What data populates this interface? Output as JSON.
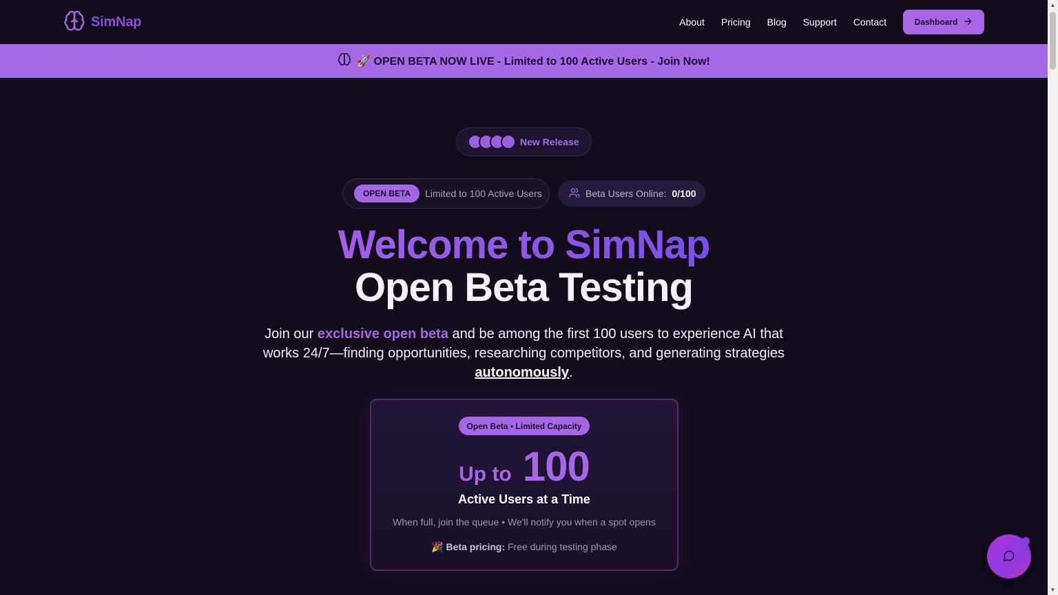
{
  "nav": {
    "brand": "SimNap",
    "links": [
      "About",
      "Pricing",
      "Blog",
      "Support",
      "Contact"
    ],
    "dashboard_label": "Dashboard"
  },
  "banner": {
    "text": "🚀 OPEN BETA NOW LIVE - Limited to 100 Active Users - Join Now!"
  },
  "release_pill": {
    "label": "New Release",
    "avatar_count": 4
  },
  "beta_pill": {
    "tag": "OPEN BETA",
    "text": "Limited to 100 Active Users"
  },
  "online_pill": {
    "label": "Beta Users Online:",
    "count": "0/100"
  },
  "hero": {
    "headline_line1": "Welcome to SimNap",
    "headline_line2": "Open Beta Testing",
    "sub_part1": "Join our ",
    "sub_highlight": "exclusive open beta",
    "sub_part2": " and be among the first 100 users to experience AI that works 24/7—finding opportunities, researching competitors, and generating strategies ",
    "sub_underline": "autonomously",
    "sub_end": "."
  },
  "capacity_card": {
    "badge": "Open Beta • Limited Capacity",
    "prefix": "Up to",
    "number": "100",
    "title": "Active Users at a Time",
    "note": "When full, join the queue • We'll notify you when a spot opens",
    "pricing_emoji": "🎉",
    "pricing_label": "Beta pricing:",
    "pricing_text": " Free during testing phase"
  },
  "colors": {
    "background": "#120c1b",
    "accent": "#a866e6",
    "banner": "#a568e6"
  },
  "icons": {
    "brand": "brain-icon",
    "dashboard_arrow": "arrow-right-icon",
    "banner": "brain-icon",
    "online": "users-icon",
    "chat": "chat-icon"
  }
}
